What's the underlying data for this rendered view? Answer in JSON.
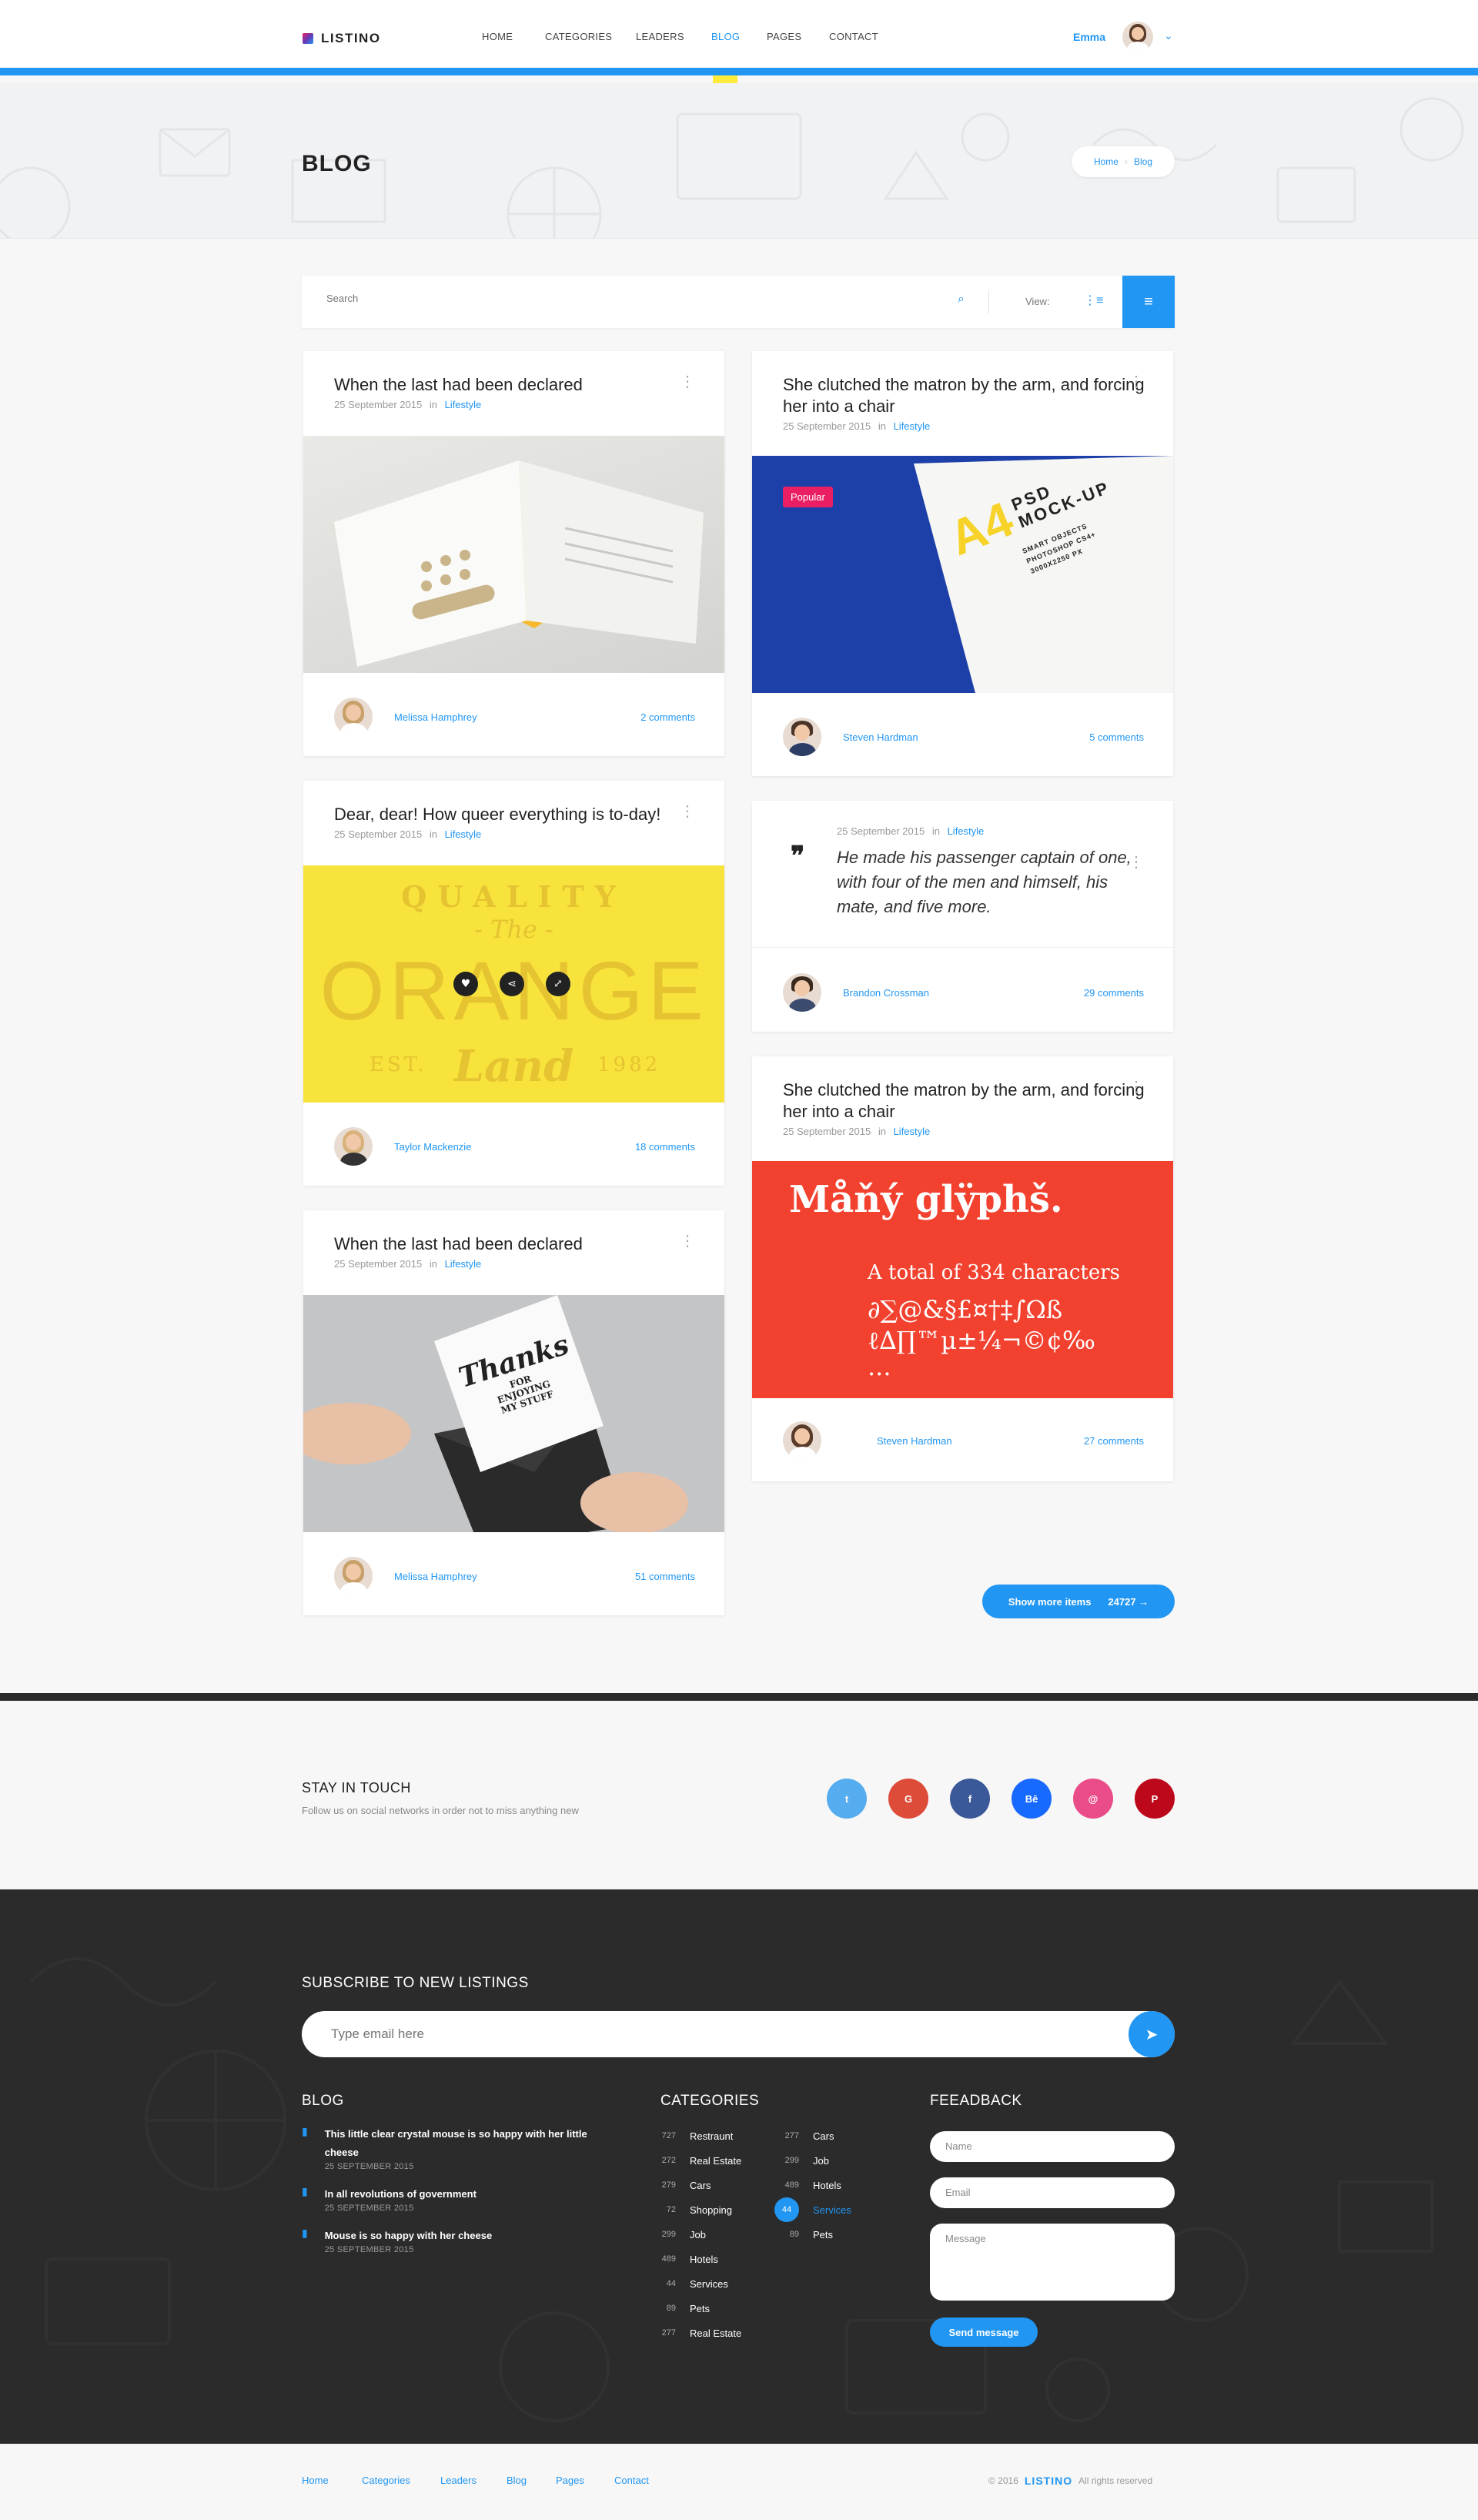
{
  "header": {
    "logo": "LISTINO",
    "nav": [
      "HOME",
      "CATEGORIES",
      "LEADERS",
      "BLOG",
      "PAGES",
      "CONTACT"
    ],
    "active_nav": "BLOG",
    "user_name": "Emma"
  },
  "title_band": {
    "title": "BLOG",
    "breadcrumb": [
      "Home",
      "Blog"
    ]
  },
  "search": {
    "placeholder": "Search",
    "view_label": "View:"
  },
  "posts": [
    {
      "title": "When the last had been declared",
      "date": "25 September 2015",
      "in": "in",
      "category": "Lifestyle",
      "author": "Melissa Hamphrey",
      "comments": "2 comments",
      "image": "open-book-icons"
    },
    {
      "title": "Dear, dear! How queer everything is to-day!",
      "date": "25 September 2015",
      "in": "in",
      "category": "Lifestyle",
      "author": "Taylor Mackenzie",
      "comments": "18 comments",
      "image": "quality-orange-land",
      "image_text": {
        "line1": "QUALITY",
        "line2": "- The -",
        "line3": "ORANGE",
        "line4": "EST.",
        "line5": "Land",
        "line6": "1982"
      }
    },
    {
      "title": "When the last had been declared",
      "date": "25 September 2015",
      "in": "in",
      "category": "Lifestyle",
      "author": "Melissa Hamphrey",
      "comments": "51 comments",
      "image": "thanks-card",
      "image_text": {
        "line1": "Thanks",
        "line2": "FOR",
        "line3": "ENJOYING",
        "line4": "MY STUFF"
      }
    },
    {
      "title": "She clutched the matron by the arm, and forcing her into a chair",
      "date": "25 September 2015",
      "in": "in",
      "category": "Lifestyle",
      "author": "Steven Hardman",
      "comments": "5 comments",
      "badge": "Popular",
      "image": "a4-psd-mockup",
      "image_text": {
        "line1": "A4",
        "line2": "PSD",
        "line3": "MOCK-UP",
        "line4": "SMART OBJECTS",
        "line5": "PHOTOSHOP CS4+",
        "line6": "3000X2250 PX"
      }
    },
    {
      "quote": "He made his passenger captain of one, with four of the men and himself, his mate, and five more.",
      "date": "25 September 2015",
      "in": "in",
      "category": "Lifestyle",
      "author": "Brandon Crossman",
      "comments": "29 comments"
    },
    {
      "title": "She clutched the matron by the arm, and forcing her into a chair",
      "date": "25 September 2015",
      "in": "in",
      "category": "Lifestyle",
      "author": "Steven Hardman",
      "comments": "27 comments",
      "image": "many-glyphs",
      "image_text": {
        "line1": "Måňý glÿphš.",
        "line2": "A total of 334 characters",
        "line3": "∂∑@&§£¤†‡∫Ωß",
        "line4": "ℓ∆∏™µ±¼¬©¢‰",
        "line5": "..."
      }
    }
  ],
  "show_more": {
    "label": "Show more items",
    "count": "24727"
  },
  "stay": {
    "title": "STAY IN TOUCH",
    "subtitle": "Follow us on social networks in order not to miss anything new",
    "socials": [
      {
        "name": "twitter",
        "glyph": "t",
        "color": "#55acee"
      },
      {
        "name": "google-plus",
        "glyph": "G",
        "color": "#dd4b39"
      },
      {
        "name": "facebook",
        "glyph": "f",
        "color": "#3b5998"
      },
      {
        "name": "behance",
        "glyph": "Bē",
        "color": "#1769ff"
      },
      {
        "name": "dribbble",
        "glyph": "@",
        "color": "#ea4c89"
      },
      {
        "name": "pinterest",
        "glyph": "P",
        "color": "#bd081c"
      }
    ]
  },
  "footer": {
    "subscribe_title": "SUBSCRIBE TO NEW LISTINGS",
    "subscribe_placeholder": "Type email here",
    "blog_title": "BLOG",
    "blog_posts": [
      {
        "title": "This little clear crystal mouse is so happy with her little cheese",
        "date": "25 SEPTEMBER 2015"
      },
      {
        "title": "In all revolutions of government",
        "date": "25 SEPTEMBER 2015"
      },
      {
        "title": "Mouse is so happy with her cheese",
        "date": "25 SEPTEMBER 2015"
      }
    ],
    "categories_title": "CATEGORIES",
    "categories_col1": [
      {
        "num": "727",
        "name": "Restraunt"
      },
      {
        "num": "272",
        "name": "Real Estate"
      },
      {
        "num": "279",
        "name": "Cars"
      },
      {
        "num": "72",
        "name": "Shopping"
      },
      {
        "num": "299",
        "name": "Job"
      },
      {
        "num": "489",
        "name": "Hotels"
      },
      {
        "num": "44",
        "name": "Services"
      },
      {
        "num": "89",
        "name": "Pets"
      },
      {
        "num": "277",
        "name": "Real Estate"
      }
    ],
    "categories_col2": [
      {
        "num": "277",
        "name": "Cars"
      },
      {
        "num": "299",
        "name": "Job"
      },
      {
        "num": "489",
        "name": "Hotels"
      },
      {
        "num": "44",
        "name": "Services",
        "active": true
      },
      {
        "num": "89",
        "name": "Pets"
      }
    ],
    "feedback_title": "FEEADBACK",
    "name_placeholder": "Name",
    "email_placeholder": "Email",
    "message_placeholder": "Message",
    "send_label": "Send message"
  },
  "bottom": {
    "links": [
      "Home",
      "Categories",
      "Leaders",
      "Blog",
      "Pages",
      "Contact"
    ],
    "copyright": "© 2016",
    "brand": "LISTINO",
    "rights": "All rights reserved"
  }
}
